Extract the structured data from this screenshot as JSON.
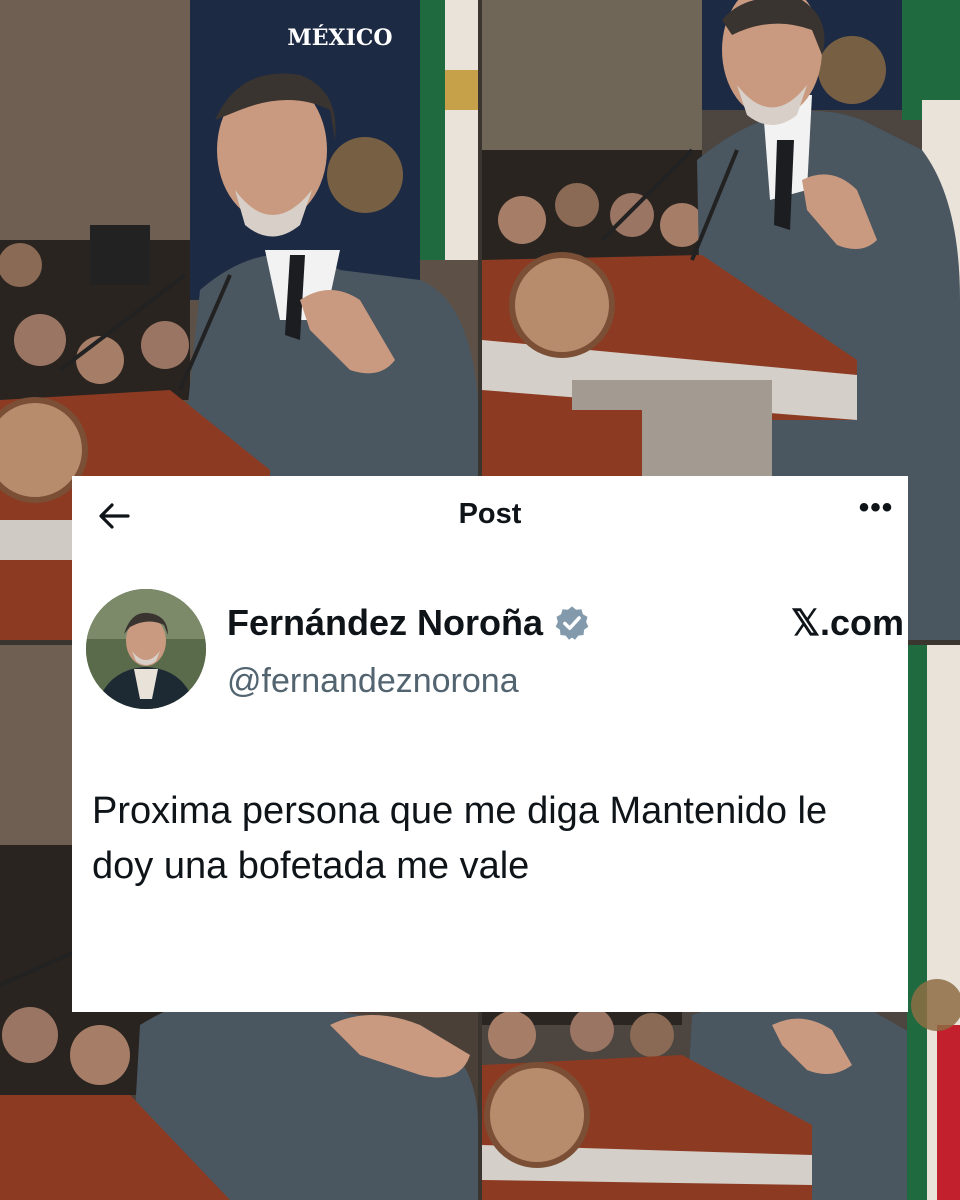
{
  "background": {
    "flag_text": "MÉXICO",
    "colors": {
      "suit": "#4a5660",
      "podium": "#8c3b22",
      "wall": "#5c5046",
      "banner": "#1d2a44",
      "flag_green": "#1f6b3f",
      "flag_red": "#c3202d"
    }
  },
  "post": {
    "header": {
      "back_icon": "arrow-left-icon",
      "title": "Post",
      "more_icon": "more-dots-icon",
      "more_label": "•••"
    },
    "author": {
      "display_name": "Fernández Noroña",
      "verified_icon": "verified-badge-icon",
      "handle": "@fernandeznorona",
      "avatar_icon": "avatar-photo"
    },
    "site_label": "𝕏.com",
    "text": "Proxima persona que me diga Mantenido le doy una bofetada me vale",
    "colors": {
      "text": "#0f1419",
      "secondary": "#536471",
      "verified": "#829aab",
      "card": "#ffffff"
    }
  }
}
